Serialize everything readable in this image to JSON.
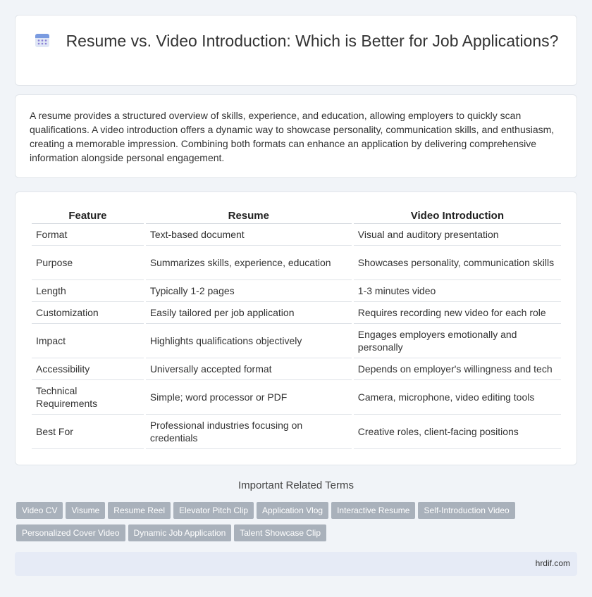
{
  "header": {
    "icon": "calendar-icon",
    "title": "Resume vs. Video Introduction: Which is Better for Job Applications?"
  },
  "intro": {
    "text": "A resume provides a structured overview of skills, experience, and education, allowing employers to quickly scan qualifications. A video introduction offers a dynamic way to showcase personality, communication skills, and enthusiasm, creating a memorable impression. Combining both formats can enhance an application by delivering comprehensive information alongside personal engagement."
  },
  "table": {
    "headers": [
      "Feature",
      "Resume",
      "Video Introduction"
    ],
    "rows": [
      [
        "Format",
        "Text-based document",
        "Visual and auditory presentation"
      ],
      [
        "Purpose",
        "Summarizes skills, experience, education",
        "Showcases personality, communication skills"
      ],
      [
        "Length",
        "Typically 1-2 pages",
        "1-3 minutes video"
      ],
      [
        "Customization",
        "Easily tailored per job application",
        "Requires recording new video for each role"
      ],
      [
        "Impact",
        "Highlights qualifications objectively",
        "Engages employers emotionally and personally"
      ],
      [
        "Accessibility",
        "Universally accepted format",
        "Depends on employer's willingness and tech"
      ],
      [
        "Technical Requirements",
        "Simple; word processor or PDF",
        "Camera, microphone, video editing tools"
      ],
      [
        "Best For",
        "Professional industries focusing on credentials",
        "Creative roles, client-facing positions"
      ]
    ]
  },
  "related": {
    "title": "Important Related Terms",
    "tags": [
      "Video CV",
      "Visume",
      "Resume Reel",
      "Elevator Pitch Clip",
      "Application Vlog",
      "Interactive Resume",
      "Self-Introduction Video",
      "Personalized Cover Video",
      "Dynamic Job Application",
      "Talent Showcase Clip"
    ]
  },
  "footer": {
    "site": "hrdif.com"
  }
}
